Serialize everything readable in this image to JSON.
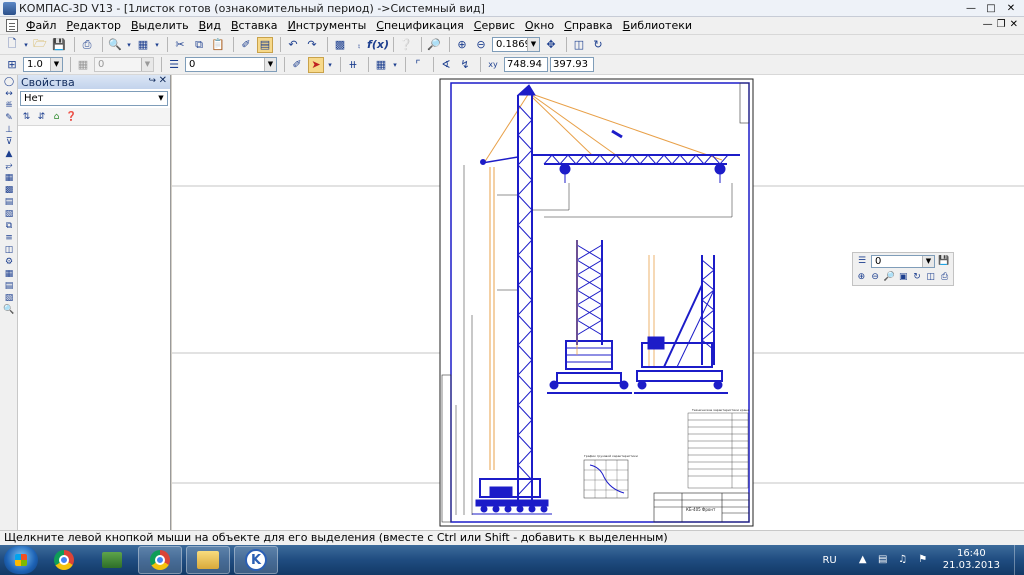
{
  "window": {
    "title": "КОМПАС-3D V13 - [1листок готов (ознакомительный период) ->Системный вид]"
  },
  "menu": [
    {
      "label": "Файл",
      "ul": "Ф",
      "rest": "айл"
    },
    {
      "label": "Редактор",
      "ul": "Р",
      "rest": "едактор"
    },
    {
      "label": "Выделить",
      "ul": "В",
      "rest": "ыделить"
    },
    {
      "label": "Вид",
      "ul": "В",
      "rest": "ид"
    },
    {
      "label": "Вставка",
      "ul": "В",
      "rest": "ставка"
    },
    {
      "label": "Инструменты",
      "ul": "И",
      "rest": "нструменты"
    },
    {
      "label": "Спецификация",
      "ul": "С",
      "rest": "пецификация"
    },
    {
      "label": "Сервис",
      "ul": "С",
      "rest": "ервис"
    },
    {
      "label": "Окно",
      "ul": "О",
      "rest": "кно"
    },
    {
      "label": "Справка",
      "ul": "С",
      "rest": "правка"
    },
    {
      "label": "Библиотеки",
      "ul": "Б",
      "rest": "иблиотеки"
    }
  ],
  "toolbar": {
    "zoom_value": "0.1869",
    "scale_value": "1.0",
    "step_value": "0",
    "layer_value": "0",
    "coord_x": "748.94",
    "coord_y": "397.93"
  },
  "properties": {
    "title": "Свойства",
    "object_value": "Нет"
  },
  "float_toolbar": {
    "layer_value": "0"
  },
  "status": {
    "text": "Щелкните левой кнопкой мыши на объекте для его выделения (вместе с Ctrl или Shift - добавить к выделенным)"
  },
  "taskbar": {
    "language": "RU",
    "time": "16:40",
    "date": "21.03.2013"
  },
  "drawing": {
    "stamp_title": "КБ-405 Фронт",
    "table_title": "Технические характеристики крана",
    "graph_title": "График грузовой характеристики"
  },
  "colors": {
    "crane_blue": "#1c1cc8",
    "cable_orange": "#e8a048",
    "frame": "#1a1a1a"
  }
}
